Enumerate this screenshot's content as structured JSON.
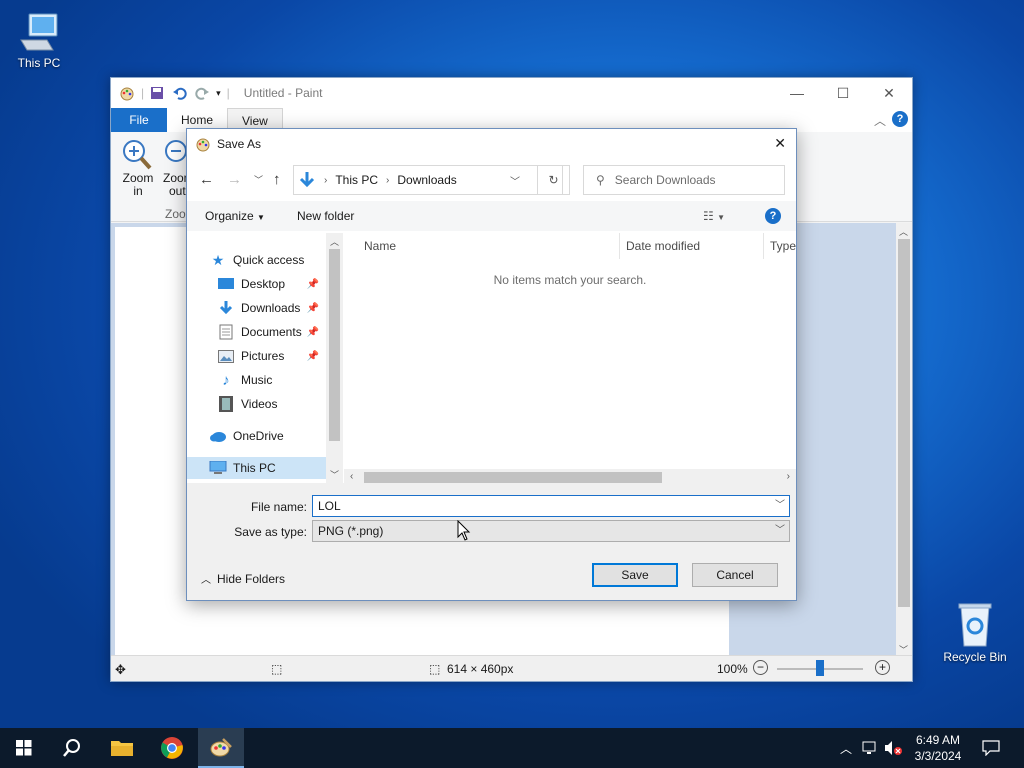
{
  "desktop": {
    "this_pc_label": "This PC",
    "recycle_bin_label": "Recycle Bin"
  },
  "paint": {
    "window_title": "Untitled - Paint",
    "tabs": {
      "file": "File",
      "home": "Home",
      "view": "View"
    },
    "ribbon": {
      "zoom_in": [
        "Zoom",
        "in"
      ],
      "zoom_out": [
        "Zoom",
        "out"
      ],
      "group_label": "Zoom"
    },
    "status": {
      "size": "614 × 460px",
      "zoom": "100%",
      "zoom_level": 1.0
    }
  },
  "dialog": {
    "title": "Save As",
    "breadcrumb": [
      "This PC",
      "Downloads"
    ],
    "search_placeholder": "Search Downloads",
    "commands": {
      "organize": "Organize",
      "new_folder": "New folder"
    },
    "nav": {
      "quick_access": "Quick access",
      "items": [
        "Desktop",
        "Downloads",
        "Documents",
        "Pictures",
        "Music",
        "Videos"
      ],
      "onedrive": "OneDrive",
      "this_pc": "This PC"
    },
    "columns": [
      "Name",
      "Date modified",
      "Type"
    ],
    "empty_message": "No items match your search.",
    "file_name_label": "File name:",
    "file_name_value": "LOL",
    "save_type_label": "Save as type:",
    "save_type_value": "PNG (*.png)",
    "hide_folders": "Hide Folders",
    "save_button": "Save",
    "cancel_button": "Cancel"
  },
  "taskbar": {
    "time": "6:49 AM",
    "date": "3/3/2024"
  },
  "colors": {
    "accent": "#0078d7",
    "file_tab": "#1a6fc9",
    "taskbar": "#0c1a2b"
  }
}
